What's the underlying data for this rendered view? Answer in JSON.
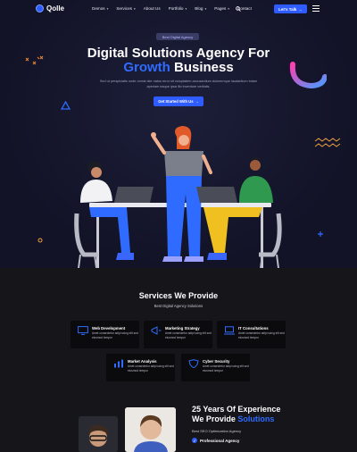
{
  "brand": {
    "name": "Qolle"
  },
  "nav": {
    "items": [
      {
        "label": "Demos",
        "caret": "▾"
      },
      {
        "label": "Services",
        "caret": "▾"
      },
      {
        "label": "About Us",
        "caret": ""
      },
      {
        "label": "Portfolio",
        "caret": "▾"
      },
      {
        "label": "Blog",
        "caret": "▾"
      },
      {
        "label": "Pages",
        "caret": "▾"
      },
      {
        "label": "Contact",
        "caret": ""
      }
    ],
    "cta_label": "Let's Talk",
    "cta_arrow": "→"
  },
  "hero": {
    "badge": "Best Digital Agency",
    "title_line1": "Digital Solutions Agency For",
    "title_highlight": "Growth",
    "title_rest": " Business",
    "description": "Sed ut perspiciatis unde omnis iste natus error sit voluptatem accusantium doloremque laudantium totam aperiam eaque ipsa illo inventore veritatis.",
    "button_label": "Get Started With Us",
    "button_arrow": "→"
  },
  "services": {
    "title": "Services We Provide",
    "subtitle": "Best Digital Agency Solutions",
    "cards": [
      {
        "title": "Web Development",
        "desc": "Amet consectetur adipi scing elit sed eiusmod tempor",
        "icon": "monitor-icon"
      },
      {
        "title": "Marketing Strategy",
        "desc": "Amet consectetur adipi scing elit sed eiusmod tempor",
        "icon": "megaphone-icon"
      },
      {
        "title": "IT Consultations",
        "desc": "Amet consectetur adipi scing elit sed eiusmod tempor",
        "icon": "laptop-code-icon"
      },
      {
        "title": "Market Analysis",
        "desc": "Amet consectetur adipi scing elit sed eiusmod tempor",
        "icon": "bar-chart-icon"
      },
      {
        "title": "Cyber Security",
        "desc": "Amet consectetur adipi scing elit sed eiusmod tempor",
        "icon": "shield-icon"
      }
    ]
  },
  "about": {
    "title_line1": "25 Years Of Experience",
    "title_line2_prefix": "We Provide ",
    "title_line2_highlight": "Solutions",
    "subtitle": "Best SEO Optimization Agency",
    "check_item": "Professional Agency",
    "check_mark": "✓"
  },
  "colors": {
    "accent": "#2f5cff",
    "background": "#15151a",
    "hero_background": "#121327"
  }
}
